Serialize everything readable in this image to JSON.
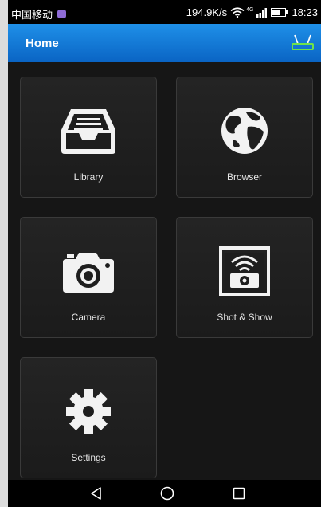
{
  "status_bar": {
    "carrier": "中国移动",
    "network_speed": "194.9K/s",
    "network_type": "4G",
    "time": "18:23",
    "icons": [
      "app-notification-icon",
      "wifi-icon",
      "signal-icon",
      "battery-icon"
    ]
  },
  "app_bar": {
    "title": "Home",
    "action_icon": "router-icon",
    "accent_color": "#1a82dc",
    "icon_color": "#6fe24a"
  },
  "tiles": [
    {
      "label": "Library",
      "icon": "inbox-tray-icon"
    },
    {
      "label": "Browser",
      "icon": "globe-icon"
    },
    {
      "label": "Camera",
      "icon": "camera-icon"
    },
    {
      "label": "Shot & Show",
      "icon": "wireless-display-icon"
    },
    {
      "label": "Settings",
      "icon": "gear-icon"
    }
  ],
  "nav_bar": {
    "buttons": [
      "back-icon",
      "home-icon",
      "recents-icon"
    ]
  }
}
